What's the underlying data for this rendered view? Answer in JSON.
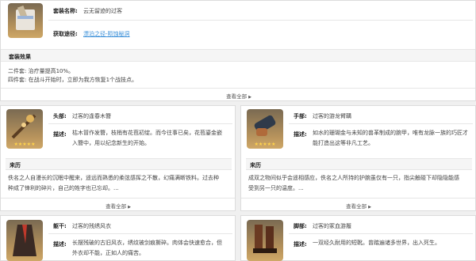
{
  "set": {
    "name_label": "套装名称:",
    "name_value": "云无留迹的过客",
    "source_label": "获取途径:",
    "source_value": "漂泊之径-陨蚀秘洞",
    "effect_header": "套装效果",
    "two_piece": "二件套: 治疗量提高10%。",
    "four_piece": "四件套: 在战斗开始时，立即为我方恢复1个战技点。",
    "view_all": "查看全部"
  },
  "head": {
    "slot_label": "头部:",
    "slot_value": "过客的逢春木簪",
    "desc_label": "描述:",
    "desc_line1": "枯木冒作发簪，枝梢有花苞初绽。而今往事已矣，花苞鎏金嵌",
    "desc_line2": "入簪中，用以纪念新生的开始。",
    "history_header": "来历",
    "history_line1": "佚名之人自漫长的沉眠中醒来，遥远而熟悉的柔弦感挥之不散，幻痛满断铁料。过去种",
    "history_line2": "种成了锋利的碎片，自己的姓字也已忘却。...",
    "view_all": "查看全部"
  },
  "hands": {
    "slot_label": "手部:",
    "slot_value": "过客的游龙臂鞲",
    "desc_label": "描述:",
    "desc_line1": "如水的珊瑚金与未知的兽革制成的腕甲，唯有龙脉一族的巧匠才",
    "desc_line2": "能打造出这等非凡工艺。",
    "history_header": "来历",
    "history_line1": "成双之物间似乎会遥相感应，佚名之人所持的护腕虽仅有一只，指尖触碰下却隐隐能感",
    "history_line2": "受到另一只的温度。...",
    "view_all": "查看全部"
  },
  "body": {
    "slot_label": "躯干:",
    "slot_value": "过客的残绣风衣",
    "desc_label": "描述:",
    "desc_line1": "长摆残破的古旧风衣，绣纹被剑痕撕碎。肉体会快速愈合，但",
    "desc_line2": "外衣却不能，正如人的痛苦。"
  },
  "feet": {
    "slot_label": "脚部:",
    "slot_value": "过客的冢血游履",
    "desc_label": "描述:",
    "desc_line1": "一双经久耐用的短靴。曾踏遍诸多世界，出入死生。"
  },
  "stars": "★★★★★",
  "colors": {
    "link": "#3a8fd8",
    "star": "#ffd34d"
  }
}
